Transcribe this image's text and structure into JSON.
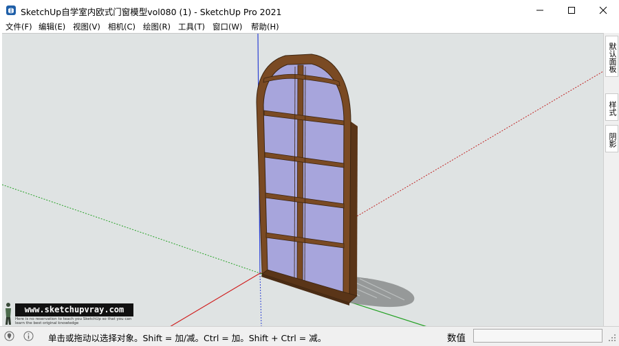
{
  "window": {
    "title": "SketchUp自学室内欧式门窗模型vol080 (1) - SketchUp Pro 2021",
    "icon": "sketchup-app-icon",
    "controls": [
      "minimize-icon",
      "maximize-icon",
      "close-icon"
    ]
  },
  "menu": {
    "items": [
      "文件(F)",
      "编辑(E)",
      "视图(V)",
      "相机(C)",
      "绘图(R)",
      "工具(T)",
      "窗口(W)",
      "帮助(H)"
    ]
  },
  "tray": {
    "tabs": [
      "默认面板",
      "样式",
      "阴影"
    ]
  },
  "watermark": {
    "site": "www.sketchupvray.com",
    "tagline": "Here is no reservation to teach you SketchUp so that you can learn the best original knowledge"
  },
  "model": {
    "name": "arched-window-frame",
    "frame_color": "#7a4a23",
    "glass_color": "#a8a6d8",
    "axis_colors": {
      "red": "#d02020",
      "green": "#20a020",
      "blue": "#2040d0"
    }
  },
  "status": {
    "icons": [
      "geo-location-icon",
      "info-icon"
    ],
    "message": "单击或拖动以选择对象。Shift = 加/减。Ctrl = 加。Shift + Ctrl = 减。",
    "vcb_label": "数值",
    "vcb_value": ""
  }
}
